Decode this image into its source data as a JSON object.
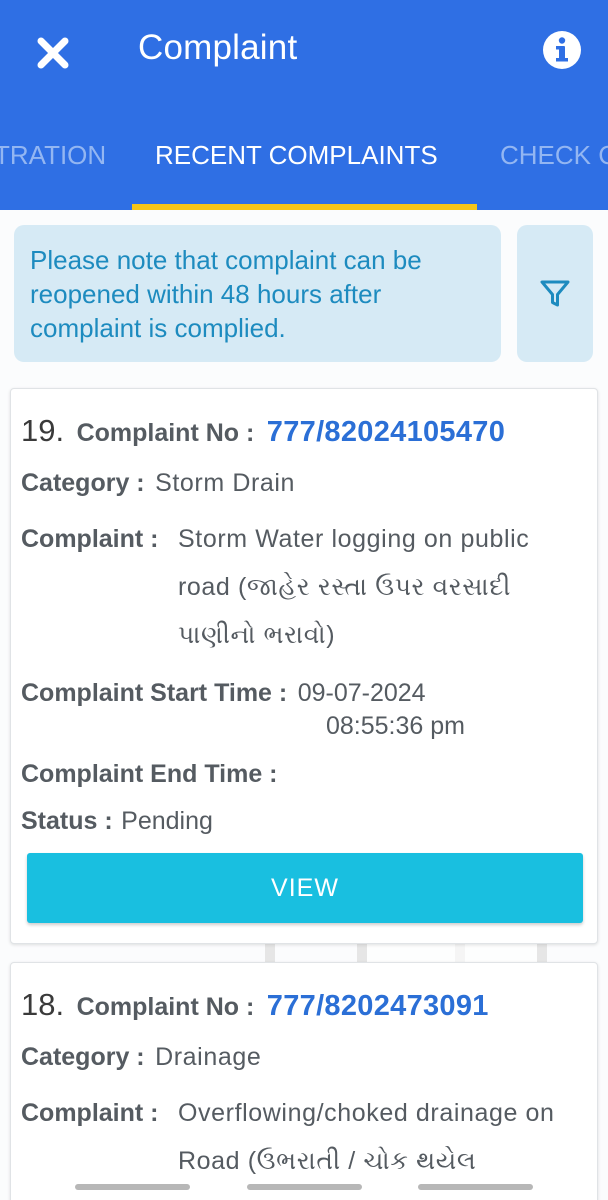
{
  "header": {
    "title": "Complaint",
    "close_icon": "close-icon",
    "info_icon": "info-icon"
  },
  "tabs": [
    {
      "label": "TRATION",
      "active": false
    },
    {
      "label": "RECENT COMPLAINTS",
      "active": true
    },
    {
      "label": "CHECK C",
      "active": false
    }
  ],
  "notice": {
    "text": "Please note that complaint can be reopened within 48 hours after complaint is complied.",
    "filter_icon": "filter-icon"
  },
  "labels": {
    "complaint_no": "Complaint No :",
    "category": "Category :",
    "complaint": "Complaint :",
    "start_time": "Complaint Start Time :",
    "end_time": "Complaint End Time :",
    "status": "Status :",
    "view": "VIEW"
  },
  "complaints": [
    {
      "index": "19.",
      "complaint_no": "777/82024105470",
      "category": "Storm Drain",
      "complaint": "Storm Water logging on public road (જાહેર રસ્તા ઉપર વરસાદી પાણીનો ભરાવો)",
      "start_date": "09-07-2024",
      "start_time": "08:55:36 pm",
      "end_time": "",
      "status": "Pending"
    },
    {
      "index": "18.",
      "complaint_no": "777/8202473091",
      "category": "Drainage",
      "complaint": "Overflowing/choked drainage on Road (ઉભરાતી / ચોક થયેલ"
    }
  ],
  "colors": {
    "primary": "#2f6fe4",
    "tab_indicator": "#f5c518",
    "notice_bg": "#d6eaf5",
    "notice_text": "#1d8bbf",
    "complaint_no": "#2b6fd6",
    "view_button": "#19bfe0"
  }
}
